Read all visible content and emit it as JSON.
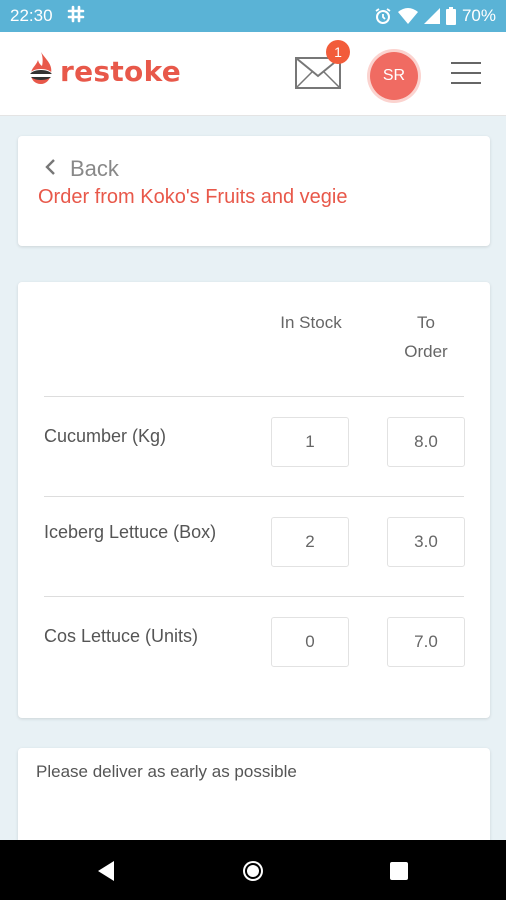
{
  "status_bar": {
    "time": "22:30",
    "battery": "70%"
  },
  "header": {
    "brand": "restoke",
    "notification_count": "1",
    "avatar_initials": "SR"
  },
  "order": {
    "back_label": "Back",
    "title": "Order from Koko's Fruits and vegie"
  },
  "table": {
    "headers": {
      "in_stock": "In Stock",
      "to_order_line1": "To",
      "to_order_line2": "Order"
    },
    "rows": [
      {
        "item": "Cucumber (Kg)",
        "in_stock": "1",
        "to_order": "8.0"
      },
      {
        "item": "Iceberg Lettuce (Box)",
        "in_stock": "2",
        "to_order": "3.0"
      },
      {
        "item": "Cos Lettuce (Units)",
        "in_stock": "0",
        "to_order": "7.0"
      }
    ]
  },
  "notes": {
    "text": "Please deliver as early as possible"
  },
  "colors": {
    "status_bar": "#5ab3d6",
    "brand": "#e8584a",
    "badge": "#f25c3a",
    "avatar": "#f06b62",
    "background": "#e8f1f5"
  },
  "icons": [
    "slack-icon",
    "alarm-icon",
    "wifi-icon",
    "signal-icon",
    "battery-icon",
    "flame-logo-icon",
    "mail-icon",
    "hamburger-menu-icon",
    "back-chevron-icon",
    "nav-back-icon",
    "nav-home-icon",
    "nav-recents-icon"
  ]
}
